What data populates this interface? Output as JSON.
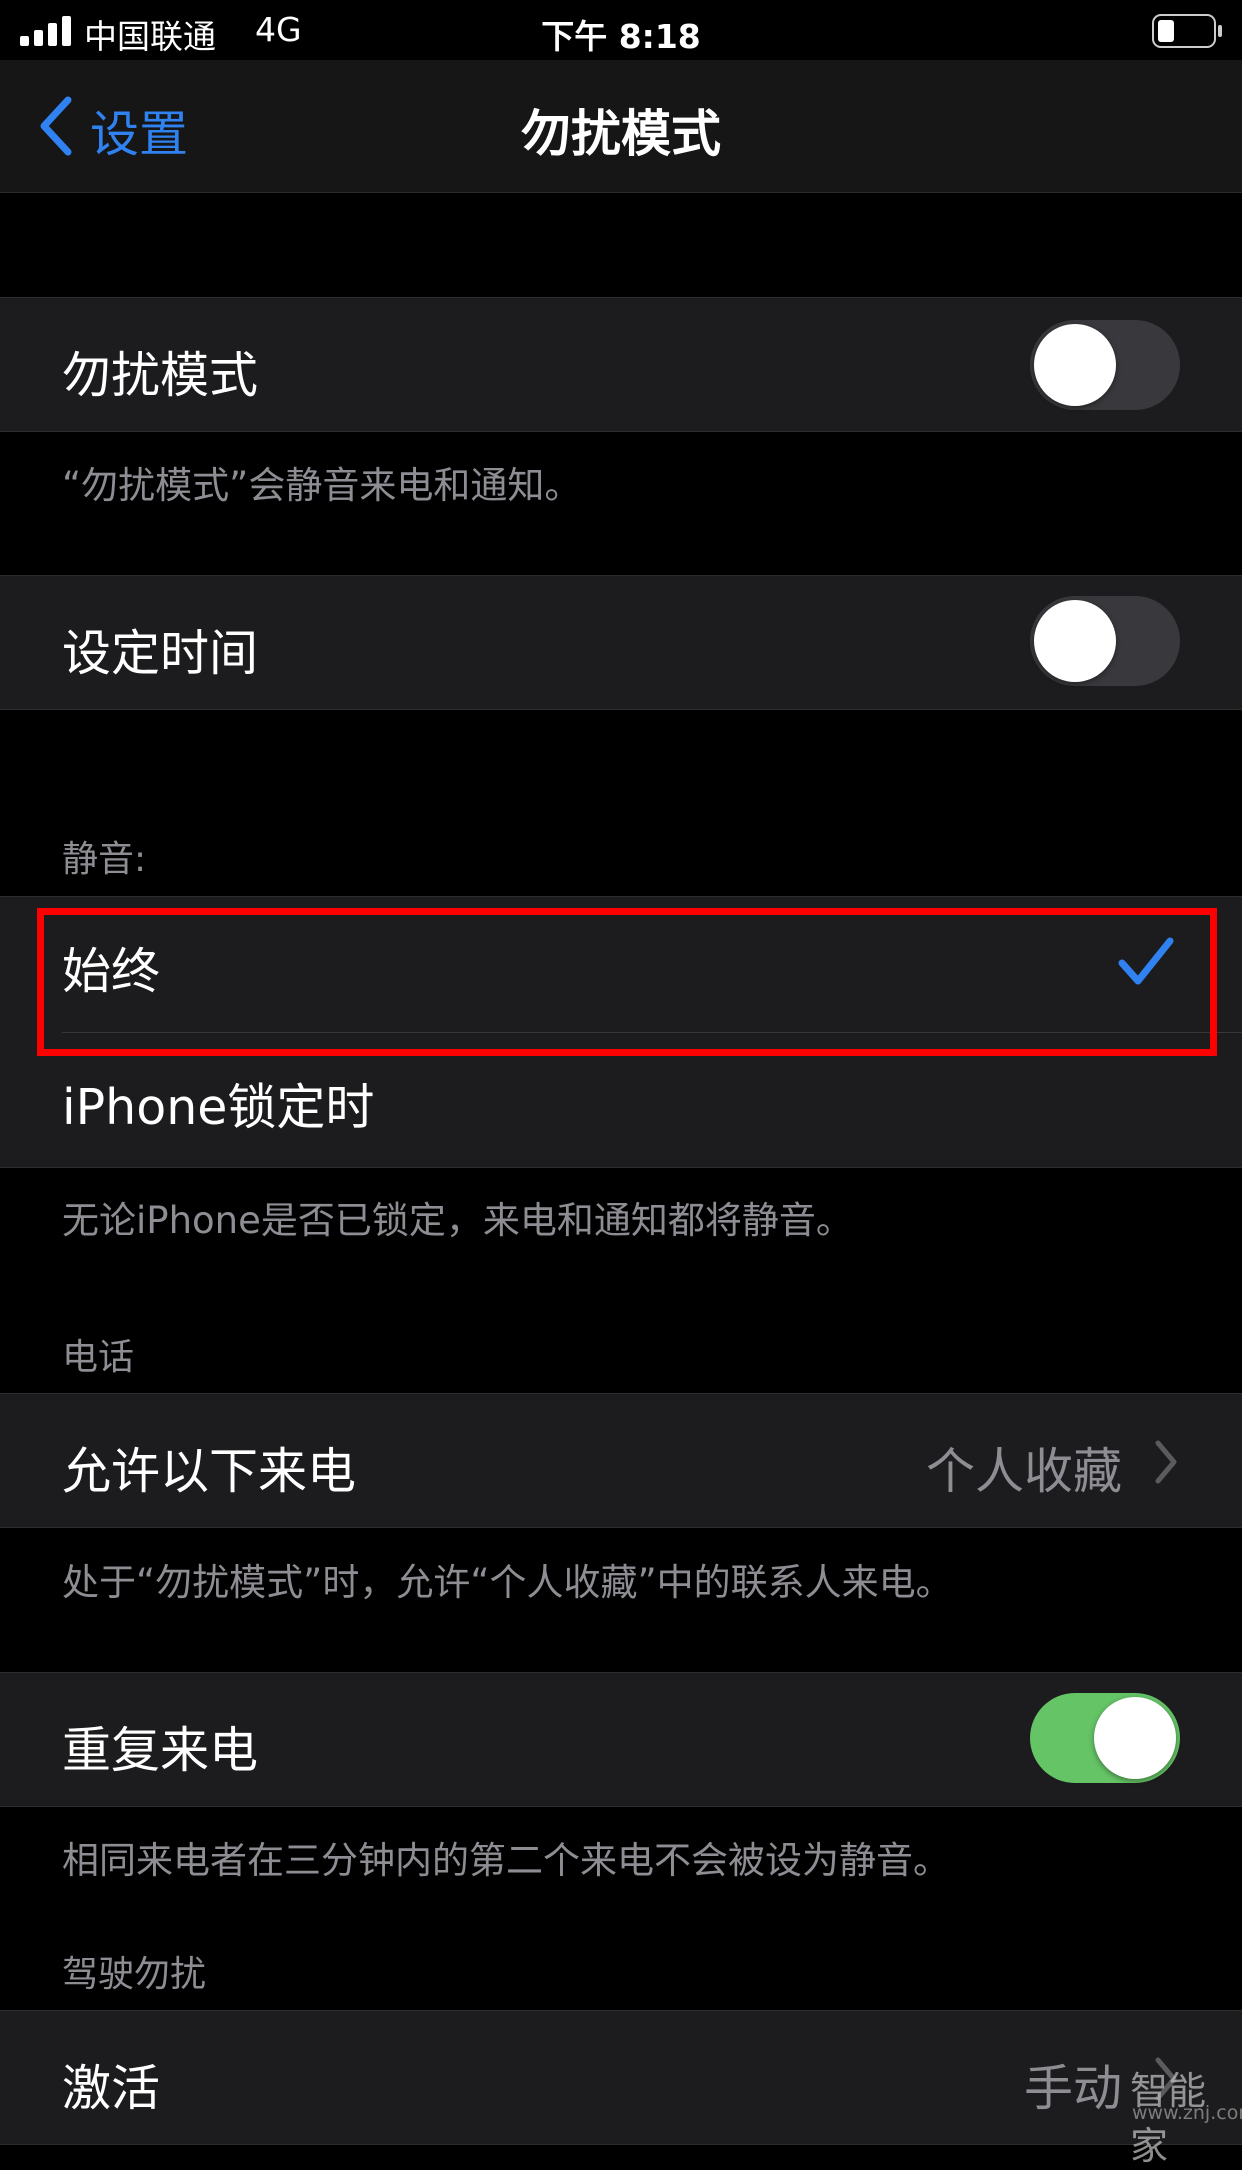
{
  "status_bar": {
    "carrier": "中国联通",
    "network": "4G",
    "time": "下午 8:18"
  },
  "nav": {
    "back_label": "设置",
    "title": "勿扰模式"
  },
  "dnd": {
    "label": "勿扰模式",
    "toggle_on": false,
    "footer": "“勿扰模式”会静音来电和通知。"
  },
  "scheduled": {
    "label": "设定时间",
    "toggle_on": false
  },
  "silence": {
    "header": "静音:",
    "options": [
      {
        "label": "始终",
        "selected": true
      },
      {
        "label": "iPhone锁定时",
        "selected": false
      }
    ],
    "footer": "无论iPhone是否已锁定，来电和通知都将静音。"
  },
  "phone": {
    "header": "电话",
    "allow_calls_label": "允许以下来电",
    "allow_calls_value": "个人收藏",
    "footer": "处于“勿扰模式”时，允许“个人收藏”中的联系人来电。",
    "repeated_calls_label": "重复来电",
    "repeated_calls_on": true,
    "repeated_footer": "相同来电者在三分钟内的第二个来电不会被设为静音。"
  },
  "driving": {
    "header": "驾驶勿扰",
    "activate_label": "激活",
    "activate_value": "手动"
  },
  "watermark": {
    "brand": "智能家",
    "url": "www.znj.com"
  },
  "colors": {
    "accent_blue": "#2f82f0",
    "toggle_on_green": "#65c466",
    "highlight_red": "#ff0000"
  }
}
